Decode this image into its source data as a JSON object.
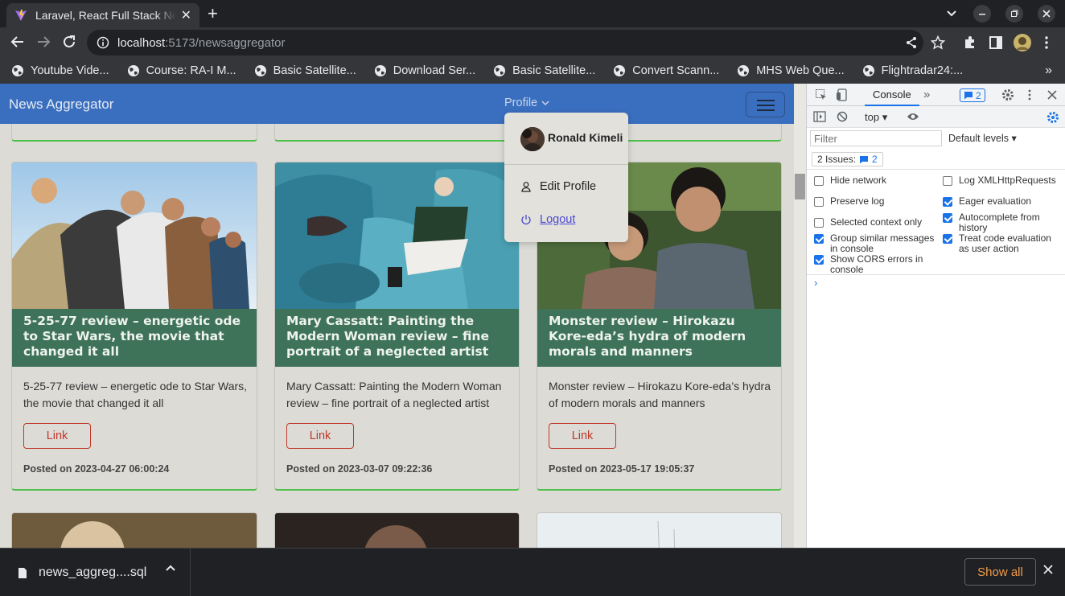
{
  "browser": {
    "tab_title": "Laravel, React Full Stack News Aggregator",
    "tab_close": "✕",
    "new_tab": "+",
    "url_host": "localhost",
    "url_path": ":5173/newsaggregator",
    "bookmarks": [
      {
        "label": "Youtube Vide..."
      },
      {
        "label": "Course: RA-I M..."
      },
      {
        "label": "Basic Satellite..."
      },
      {
        "label": "Download Ser..."
      },
      {
        "label": "Basic Satellite..."
      },
      {
        "label": "Convert Scann..."
      },
      {
        "label": "MHS Web Que..."
      },
      {
        "label": "Flightradar24:..."
      }
    ],
    "bookmarks_more": "»"
  },
  "app": {
    "brand": "News Aggregator",
    "profile_label": "Profile",
    "dropdown": {
      "user_name": "Ronald Kimeli",
      "edit_profile": "Edit Profile",
      "logout": "Logout"
    },
    "cards": [
      {
        "title": "5-25-77 review – energetic ode to Star Wars, the movie that changed it all",
        "description": "5-25-77 review – energetic ode to Star Wars, the movie that changed it all",
        "link_label": "Link",
        "posted_label": "Posted on",
        "posted_date": "2023-04-27 06:00:24"
      },
      {
        "title": "Mary Cassatt: Painting the Modern Woman review – fine portrait of a neglected artist",
        "description": "Mary Cassatt: Painting the Modern Woman review – fine portrait of a neglected artist",
        "link_label": "Link",
        "posted_label": "Posted on",
        "posted_date": "2023-03-07 09:22:36"
      },
      {
        "title": "Monster review – Hirokazu Kore-eda’s hydra of modern morals and manners",
        "description": "Monster review – Hirokazu Kore-eda’s hydra of modern morals and manners",
        "link_label": "Link",
        "posted_label": "Posted on",
        "posted_date": "2023-05-17 19:05:37"
      }
    ],
    "colors": {
      "navbar": "#3a6fbf",
      "card_title_bg": "#3f7359",
      "accent_border": "#4fc04a",
      "link": "#c0392b"
    }
  },
  "devtools": {
    "console_tab": "Console",
    "more_tabs": "»",
    "issues_badge_count": "2",
    "context": "top",
    "filter_placeholder": "Filter",
    "levels": "Default levels",
    "issues_label": "2 Issues:",
    "issues_count": "2",
    "prompt": "›",
    "settings": [
      {
        "label": "Hide network",
        "checked": false
      },
      {
        "label": "Log XMLHttpRequests",
        "checked": false
      },
      {
        "label": "Preserve log",
        "checked": false
      },
      {
        "label": "Eager evaluation",
        "checked": true
      },
      {
        "label": "Selected context only",
        "checked": false
      },
      {
        "label": "Autocomplete from history",
        "checked": true
      },
      {
        "label": "Group similar messages in console",
        "checked": true
      },
      {
        "label": "Treat code evaluation as user action",
        "checked": true
      },
      {
        "label": "Show CORS errors in console",
        "checked": true
      }
    ]
  },
  "downloads": {
    "file_name": "news_aggreg....sql",
    "show_all": "Show all"
  }
}
